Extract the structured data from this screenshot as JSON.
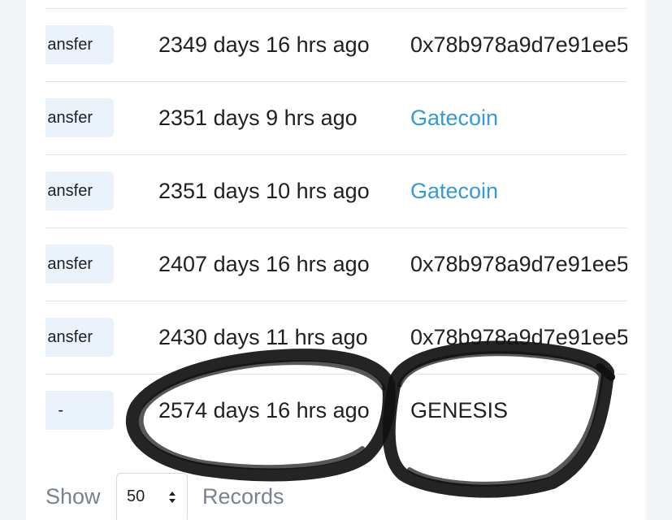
{
  "rows": [
    {
      "method": "ansfer",
      "age": "2349 days 16 hrs ago",
      "from": "0x78b978a9d7e91ee5",
      "from_is_link": false
    },
    {
      "method": "ansfer",
      "age": "2351 days 9 hrs ago",
      "from": "Gatecoin",
      "from_is_link": true
    },
    {
      "method": "ansfer",
      "age": "2351 days 10 hrs ago",
      "from": "Gatecoin",
      "from_is_link": true
    },
    {
      "method": "ansfer",
      "age": "2407 days 16 hrs ago",
      "from": "0x78b978a9d7e91ee5",
      "from_is_link": false
    },
    {
      "method": "ansfer",
      "age": "2430 days 11 hrs ago",
      "from": "0x78b978a9d7e91ee5",
      "from_is_link": false
    },
    {
      "method": "-",
      "age": "2574 days 16 hrs ago",
      "from": "GENESIS",
      "from_is_link": false
    }
  ],
  "footer": {
    "show_label": "Show",
    "page_size_value": "50",
    "records_label": "Records"
  },
  "colors": {
    "link": "#3498db",
    "badge_bg": "#eaf3fc",
    "text": "#1e2022",
    "muted": "#77838f"
  },
  "icons": {
    "select_arrows": "sort-updown-icon"
  }
}
